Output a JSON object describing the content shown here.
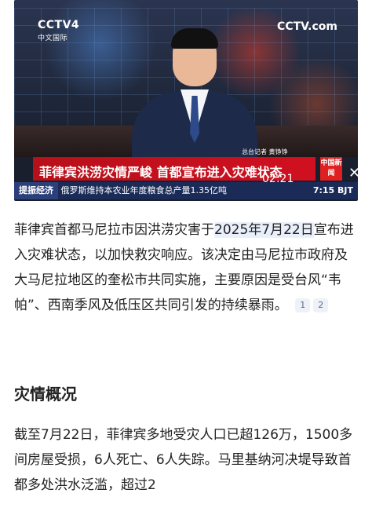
{
  "video": {
    "channel_logo": "CCTV4",
    "channel_sub": "中文国际",
    "corner_logo": "CCTV.com",
    "reporter": "总台记者 黄铮铮",
    "headline": "菲律宾洪涝灾情严峻 首都宣布进入灾难状态",
    "badge": "中国新闻",
    "timecode": "02:21",
    "ticker_tag": "提振经济",
    "ticker_text": "俄罗斯维持本农业年度粮食总产量1.35亿吨",
    "ticker_time": "7:15 BJT"
  },
  "article": {
    "p1_part1": "菲律宾首都马尼拉市因洪涝灾害于",
    "p1_highlight": "2025年7月22日",
    "p1_part2": "宣布进入灾难状态，以加快救灾响应。该决定由马尼拉市政府及大马尼拉地区的奎松市共同实施，主要原因是受台风“韦帕”、西南季风及低压区共同引发的持续暴雨。",
    "citations": [
      "1",
      "2"
    ],
    "section_title": "灾情概况",
    "p2": "截至7月22日，菲律宾多地受灾人口已超126万，1500多间房屋受损，6人死亡、6人失踪。马里基纳河决堤导致首都多处洪水泛滥，超过2"
  }
}
